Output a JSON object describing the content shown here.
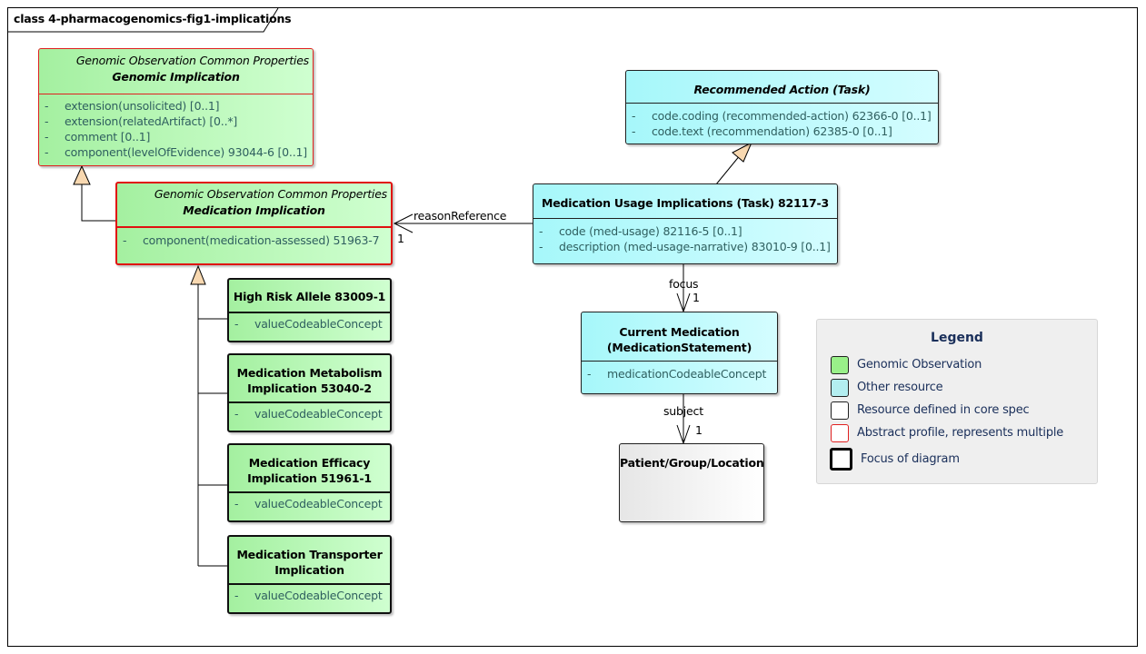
{
  "diagram": {
    "title": "class 4-pharmacogenomics-fig1-implications"
  },
  "classes": {
    "genomic_implication": {
      "stereotype": "Genomic Observation Common Properties",
      "name": "Genomic Implication",
      "attributes": [
        {
          "vis": "-",
          "text": "extension(unsolicited) [0..1]"
        },
        {
          "vis": "-",
          "text": "extension(relatedArtifact) [0..*]"
        },
        {
          "vis": "-",
          "text": "comment [0..1]"
        },
        {
          "vis": "-",
          "text": "component(levelOfEvidence) 93044-6 [0..1]"
        }
      ]
    },
    "medication_implication": {
      "stereotype": "Genomic Observation Common Properties",
      "name": "Medication Implication",
      "attributes": [
        {
          "vis": "-",
          "text": "component(medication-assessed) 51963-7"
        }
      ]
    },
    "high_risk_allele": {
      "name_lines": [
        "High Risk Allele 83009-1"
      ],
      "attributes": [
        {
          "vis": "-",
          "text": "valueCodeableConcept"
        }
      ]
    },
    "metabolism": {
      "name_lines": [
        "Medication Metabolism",
        "Implication 53040-2"
      ],
      "attributes": [
        {
          "vis": "-",
          "text": "valueCodeableConcept"
        }
      ]
    },
    "efficacy": {
      "name_lines": [
        "Medication Efficacy",
        "Implication 51961-1"
      ],
      "attributes": [
        {
          "vis": "-",
          "text": "valueCodeableConcept"
        }
      ]
    },
    "transporter": {
      "name_lines": [
        "Medication Transporter",
        "Implication"
      ],
      "attributes": [
        {
          "vis": "-",
          "text": "valueCodeableConcept"
        }
      ]
    },
    "recommended_action": {
      "name": "Recommended Action (Task)",
      "attributes": [
        {
          "vis": "-",
          "text": "code.coding (recommended-action) 62366-0 [0..1]"
        },
        {
          "vis": "-",
          "text": "code.text (recommendation) 62385-0 [0..1]"
        }
      ]
    },
    "med_usage": {
      "name": "Medication Usage Implications (Task) 82117-3",
      "attributes": [
        {
          "vis": "-",
          "text": "code (med-usage) 82116-5 [0..1]"
        },
        {
          "vis": "-",
          "text": "description (med-usage-narrative) 83010-9 [0..1]"
        }
      ]
    },
    "current_medication": {
      "name_lines": [
        "Current Medication",
        "(MedicationStatement)"
      ],
      "attributes": [
        {
          "vis": "-",
          "text": "medicationCodeableConcept"
        }
      ]
    },
    "patient": {
      "name": "Patient/Group/Location"
    }
  },
  "associations": {
    "reason_reference": {
      "role": "reasonReference",
      "multiplicity": "1"
    },
    "focus": {
      "role": "focus",
      "multiplicity": "1"
    },
    "subject": {
      "role": "subject",
      "multiplicity": "1"
    }
  },
  "legend": {
    "title": "Legend",
    "items": [
      {
        "label": "Genomic Observation",
        "fill": "#99f089",
        "border": "#202020"
      },
      {
        "label": "Other resource",
        "fill": "#b3eef0",
        "border": "#202020"
      },
      {
        "label": "Resource defined in core spec",
        "fill": "#ffffff",
        "border": "#202020"
      },
      {
        "label": "Abstract profile, represents multiple",
        "fill": "#ffffff",
        "border": "#e02020"
      },
      {
        "label": "Focus of diagram",
        "fill": "#ffffff",
        "border": "#000000"
      }
    ]
  },
  "colors": {
    "genomic_fill": "#b5f5b0",
    "resource_fill": "#bdfbfd",
    "abstract_border": "#e02020",
    "generalization_arrow": "#f8d8b0",
    "legend_text": "#1a2f5a",
    "attribute_text": "#2f5f5f"
  }
}
